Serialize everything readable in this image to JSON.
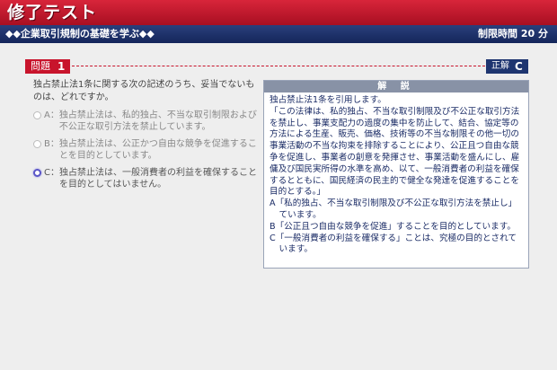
{
  "header": {
    "app_title": "修了テスト",
    "course_title": "◆◆企業取引規制の基礎を学ぶ◆◆",
    "time_limit": "制限時間 20 分"
  },
  "question": {
    "label": "問題",
    "number": "1",
    "text": "独占禁止法1条に関する次の記述のうち、妥当でないものは、どれですか。",
    "choices": [
      {
        "letter": "A：",
        "text": "独占禁止法は、私的独占、不当な取引制限および不公正な取引方法を禁止しています。"
      },
      {
        "letter": "B：",
        "text": "独占禁止法は、公正かつ自由な競争を促進することを目的としています。"
      },
      {
        "letter": "C：",
        "text": "独占禁止法は、一般消費者の利益を確保することを目的としてはいません。"
      }
    ]
  },
  "answer": {
    "label": "正解",
    "value": "C"
  },
  "explanation": {
    "header": "解 説",
    "lines": [
      "独占禁止法1条を引用します。",
      "「この法律は、私的独占、不当な取引制限及び不公正な取引方法を禁止し、事業支配力の過度の集中を防止して、結合、協定等の方法による生産、販売、価格、技術等の不当な制限その他一切の事業活動の不当な拘束を排除することにより、公正且つ自由な競争を促進し、事業者の創意を発揮させ、事業活動を盛んにし、雇傭及び国民実所得の水準を高め、以て、一般消費者の利益を確保するとともに、国民経済の民主的で健全な発達を促進することを目的とする。」",
      "A「私的独占、不当な取引制限及び不公正な取引方法を禁止し」ています。",
      "B「公正且つ自由な競争を促進」することを目的としています。",
      "C「一般消費者の利益を確保する」ことは、究極の目的とされています。"
    ]
  },
  "colors": {
    "header_red": "#c8142c",
    "navy": "#1e3570",
    "explain_text": "#1b2c66",
    "selected_radio": "#5b56c7"
  }
}
